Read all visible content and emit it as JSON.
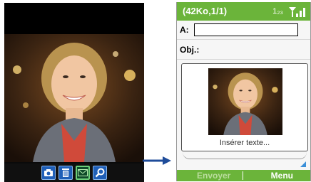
{
  "left_phone": {
    "toolbar": [
      {
        "icon": "camera-icon"
      },
      {
        "icon": "trash-icon"
      },
      {
        "icon": "envelope-icon",
        "selected": true
      },
      {
        "icon": "zoom-icon"
      }
    ]
  },
  "right_phone": {
    "title": "(42Ko,1/1)",
    "indicator": "1₂₃",
    "to_label": "A:",
    "to_value": "",
    "subject_label": "Obj.:",
    "slide_caption": "Insérer texte...",
    "softkey_left": "Envoyer",
    "softkey_right": "Menu"
  },
  "colors": {
    "title_bar": "#6bb43a",
    "arrow": "#1f4c9a"
  }
}
